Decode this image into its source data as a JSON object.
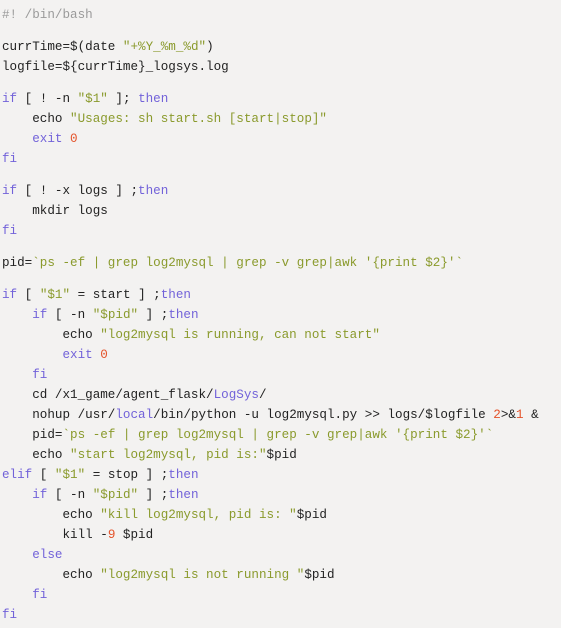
{
  "colors": {
    "background": "#f3f2f1",
    "keyword": "#7262d9",
    "string": "#8a9a2c",
    "number": "#e4532a",
    "comment": "#9a9a9a",
    "plain": "#222222"
  },
  "code_groups": [
    [
      [
        [
          "c",
          "#! /bin/bash"
        ]
      ]
    ],
    [
      [
        [
          "p",
          "currTime=$(date "
        ],
        [
          "s",
          "\"+%Y_%m_%d\""
        ],
        [
          "p",
          ")"
        ]
      ],
      [
        [
          "p",
          "logfile=${currTime}_logsys.log"
        ]
      ]
    ],
    [
      [
        [
          "k",
          "if"
        ],
        [
          "p",
          " [ ! -n "
        ],
        [
          "s",
          "\"$1\""
        ],
        [
          "p",
          " ]; "
        ],
        [
          "k",
          "then"
        ]
      ],
      [
        [
          "p",
          "    echo "
        ],
        [
          "s",
          "\"Usages: sh start.sh [start|stop]\""
        ]
      ],
      [
        [
          "p",
          "    "
        ],
        [
          "k",
          "exit"
        ],
        [
          "p",
          " "
        ],
        [
          "n",
          "0"
        ]
      ],
      [
        [
          "k",
          "fi"
        ]
      ]
    ],
    [
      [
        [
          "k",
          "if"
        ],
        [
          "p",
          " [ ! -x logs ] ;"
        ],
        [
          "k",
          "then"
        ]
      ],
      [
        [
          "p",
          "    mkdir logs"
        ]
      ],
      [
        [
          "k",
          "fi"
        ]
      ]
    ],
    [
      [
        [
          "p",
          "pid="
        ],
        [
          "s",
          "`ps -ef | grep log2mysql | grep -v grep|awk '{print $2}'`"
        ]
      ]
    ],
    [
      [
        [
          "k",
          "if"
        ],
        [
          "p",
          " [ "
        ],
        [
          "s",
          "\"$1\""
        ],
        [
          "p",
          " = start ] ;"
        ],
        [
          "k",
          "then"
        ]
      ],
      [
        [
          "p",
          "    "
        ],
        [
          "k",
          "if"
        ],
        [
          "p",
          " [ -n "
        ],
        [
          "s",
          "\"$pid\""
        ],
        [
          "p",
          " ] ;"
        ],
        [
          "k",
          "then"
        ]
      ],
      [
        [
          "p",
          "        echo "
        ],
        [
          "s",
          "\"log2mysql is running, can not start\""
        ]
      ],
      [
        [
          "p",
          "        "
        ],
        [
          "k",
          "exit"
        ],
        [
          "p",
          " "
        ],
        [
          "n",
          "0"
        ]
      ],
      [
        [
          "p",
          "    "
        ],
        [
          "k",
          "fi"
        ]
      ],
      [
        [
          "p",
          "    cd /x1_game/agent_flask/"
        ],
        [
          "k",
          "LogSys"
        ],
        [
          "p",
          "/"
        ]
      ],
      [
        [
          "p",
          "    nohup /usr/"
        ],
        [
          "k",
          "local"
        ],
        [
          "p",
          "/bin/python -u log2mysql.py >> logs/$logfile "
        ],
        [
          "n",
          "2"
        ],
        [
          "p",
          ">&"
        ],
        [
          "n",
          "1"
        ],
        [
          "p",
          " &"
        ]
      ],
      [
        [
          "p",
          "    pid="
        ],
        [
          "s",
          "`ps -ef | grep log2mysql | grep -v grep|awk '{print $2}'`"
        ]
      ],
      [
        [
          "p",
          "    echo "
        ],
        [
          "s",
          "\"start log2mysql, pid is:\""
        ],
        [
          "p",
          "$pid"
        ]
      ],
      [
        [
          "k",
          "elif"
        ],
        [
          "p",
          " [ "
        ],
        [
          "s",
          "\"$1\""
        ],
        [
          "p",
          " = stop ] ;"
        ],
        [
          "k",
          "then"
        ]
      ],
      [
        [
          "p",
          "    "
        ],
        [
          "k",
          "if"
        ],
        [
          "p",
          " [ -n "
        ],
        [
          "s",
          "\"$pid\""
        ],
        [
          "p",
          " ] ;"
        ],
        [
          "k",
          "then"
        ]
      ],
      [
        [
          "p",
          "        echo "
        ],
        [
          "s",
          "\"kill log2mysql, pid is: \""
        ],
        [
          "p",
          "$pid"
        ]
      ],
      [
        [
          "p",
          "        kill -"
        ],
        [
          "n",
          "9"
        ],
        [
          "p",
          " $pid"
        ]
      ],
      [
        [
          "p",
          "    "
        ],
        [
          "k",
          "else"
        ]
      ],
      [
        [
          "p",
          "        echo "
        ],
        [
          "s",
          "\"log2mysql is not running \""
        ],
        [
          "p",
          "$pid"
        ]
      ],
      [
        [
          "p",
          "    "
        ],
        [
          "k",
          "fi"
        ]
      ],
      [
        [
          "k",
          "fi"
        ]
      ]
    ]
  ]
}
